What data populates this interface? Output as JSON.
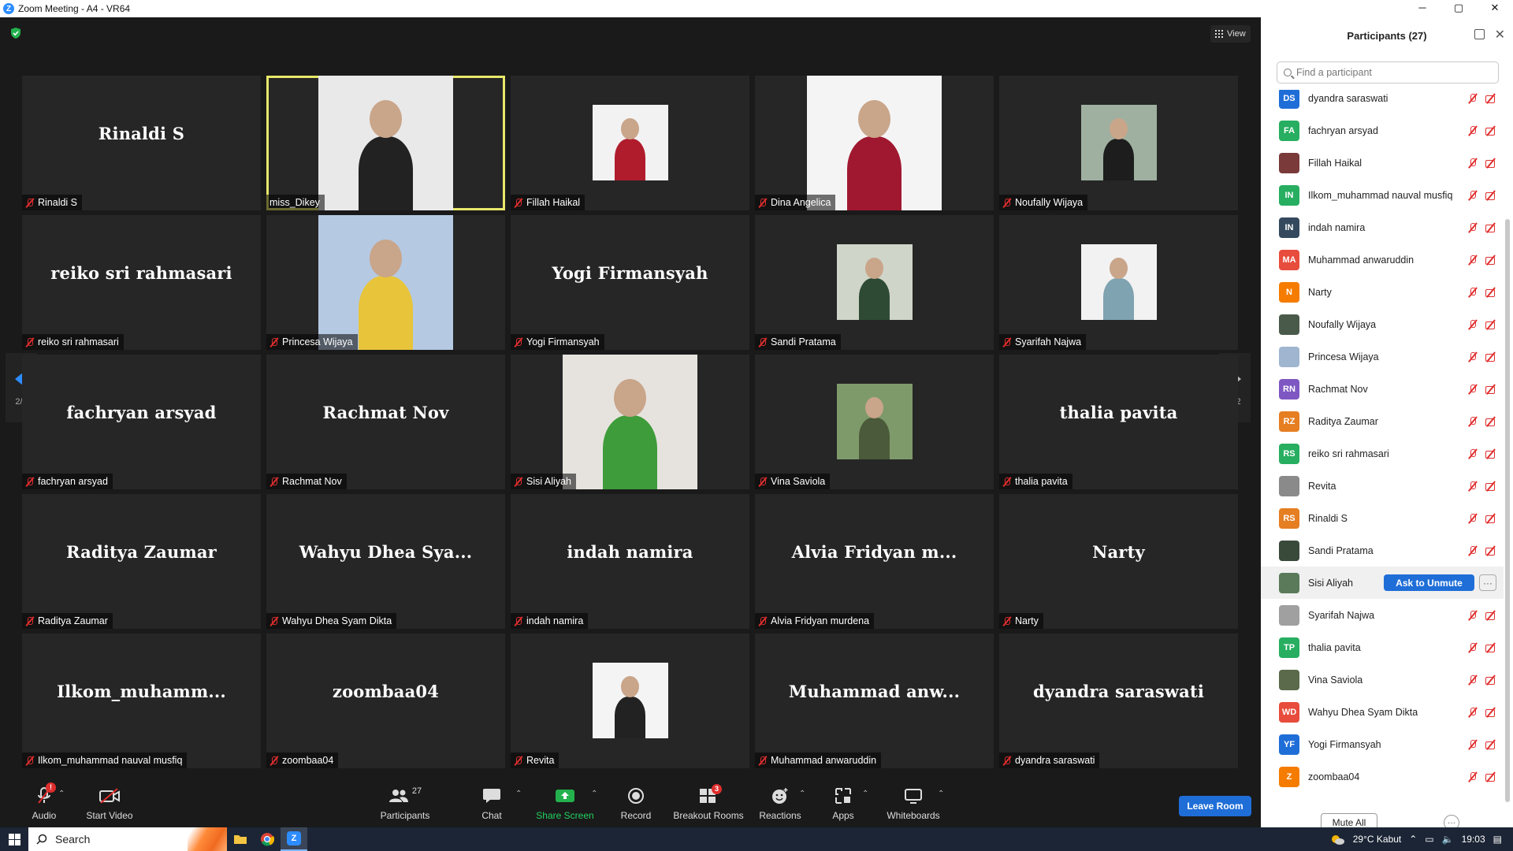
{
  "window": {
    "title": "Zoom Meeting - A4 - VR64",
    "minimize": "─",
    "maximize": "▢",
    "close": "✕"
  },
  "view_button": "View",
  "tiles": [
    {
      "id": "rinaldi",
      "big": "Rinaldi S",
      "name": "Rinaldi S",
      "photo": false
    },
    {
      "id": "dikey",
      "big": "",
      "name": "miss_Dikey",
      "photo": true,
      "active": true,
      "photo_color": "#e9e9e9",
      "accent": "#222"
    },
    {
      "id": "fillah",
      "big": "",
      "name": "Fillah Haikal",
      "photo": true,
      "small": true,
      "photo_color": "#f2f2f2",
      "accent": "#b01c2c"
    },
    {
      "id": "dina",
      "big": "",
      "name": "Dina Angelica",
      "photo": true,
      "photo_color": "#f4f4f4",
      "accent": "#a01830"
    },
    {
      "id": "noufally",
      "big": "",
      "name": "Noufally Wijaya",
      "photo": true,
      "small": true,
      "photo_color": "#9fb0a0",
      "accent": "#1d1d1d"
    },
    {
      "id": "reiko",
      "big": "reiko sri rahmasari",
      "name": "reiko sri rahmasari",
      "photo": false
    },
    {
      "id": "princesa",
      "big": "",
      "name": "Princesa Wijaya",
      "photo": true,
      "photo_color": "#b5c9e2",
      "accent": "#e8c43a"
    },
    {
      "id": "yogi",
      "big": "Yogi Firmansyah",
      "name": "Yogi Firmansyah",
      "photo": false
    },
    {
      "id": "sandi",
      "big": "",
      "name": "Sandi Pratama",
      "photo": true,
      "small": true,
      "photo_color": "#cfd5c8",
      "accent": "#2e4a34"
    },
    {
      "id": "syarifah",
      "big": "",
      "name": "Syarifah Najwa",
      "photo": true,
      "small": true,
      "photo_color": "#f2f2f2",
      "accent": "#7fa3b0"
    },
    {
      "id": "fachryan",
      "big": "fachryan arsyad",
      "name": "fachryan arsyad",
      "photo": false
    },
    {
      "id": "rachmat",
      "big": "Rachmat Nov",
      "name": "Rachmat Nov",
      "photo": false
    },
    {
      "id": "sisi",
      "big": "",
      "name": "Sisi Aliyah",
      "photo": true,
      "photo_color": "#e6e3df",
      "accent": "#3f9c3a"
    },
    {
      "id": "vina",
      "big": "",
      "name": "Vina Saviola",
      "photo": true,
      "small": true,
      "photo_color": "#7e9a6a",
      "accent": "#4a5a3a"
    },
    {
      "id": "thalia",
      "big": "thalia pavita",
      "name": "thalia pavita",
      "photo": false
    },
    {
      "id": "raditya",
      "big": "Raditya Zaumar",
      "name": "Raditya Zaumar",
      "photo": false
    },
    {
      "id": "wahyu",
      "big": "Wahyu Dhea Sya...",
      "name": "Wahyu Dhea Syam Dikta",
      "photo": false
    },
    {
      "id": "indah",
      "big": "indah namira",
      "name": "indah namira",
      "photo": false
    },
    {
      "id": "alvia",
      "big": "Alvia Fridyan m...",
      "name": "Alvia Fridyan murdena",
      "photo": false
    },
    {
      "id": "narty",
      "big": "Narty",
      "name": "Narty",
      "photo": false
    },
    {
      "id": "ilkom",
      "big": "Ilkom_muhamm...",
      "name": "Ilkom_muhammad nauval musfiq",
      "photo": false
    },
    {
      "id": "zoombaa",
      "big": "zoombaa04",
      "name": "zoombaa04",
      "photo": false
    },
    {
      "id": "revita",
      "big": "",
      "name": "Revita",
      "photo": true,
      "small": true,
      "photo_color": "#f4f4f4",
      "accent": "#222"
    },
    {
      "id": "muhammad",
      "big": "Muhammad anw...",
      "name": "Muhammad anwaruddin",
      "photo": false
    },
    {
      "id": "dyandra",
      "big": "dyandra saraswati",
      "name": "dyandra saraswati",
      "photo": false
    }
  ],
  "pagination": {
    "left": "2/2",
    "right": "2/2"
  },
  "toolbar": {
    "audio": "Audio",
    "audio_badge": "!",
    "start_video": "Start Video",
    "participants": "Participants",
    "participants_count": "27",
    "chat": "Chat",
    "share_screen": "Share Screen",
    "record": "Record",
    "breakout_rooms": "Breakout Rooms",
    "breakout_badge": "3",
    "reactions": "Reactions",
    "apps": "Apps",
    "whiteboards": "Whiteboards",
    "leave": "Leave Room"
  },
  "panel": {
    "title": "Participants (27)",
    "search_placeholder": "Find a participant",
    "mute_all": "Mute All",
    "more": "···",
    "ask_to_unmute": "Ask to Unmute",
    "row_more": "···",
    "participants": [
      {
        "initials": "DS",
        "name": "dyandra saraswati",
        "color": "#1f6ed8"
      },
      {
        "initials": "FA",
        "name": "fachryan arsyad",
        "color": "#27ae60"
      },
      {
        "initials": "",
        "name": "Fillah Haikal",
        "color": "#7a3a3a",
        "photo": true
      },
      {
        "initials": "IN",
        "name": "Ilkom_muhammad nauval musfiq",
        "color": "#27ae60"
      },
      {
        "initials": "IN",
        "name": "indah namira",
        "color": "#34495e"
      },
      {
        "initials": "MA",
        "name": "Muhammad anwaruddin",
        "color": "#e74c3c"
      },
      {
        "initials": "N",
        "name": "Narty",
        "color": "#f57c00"
      },
      {
        "initials": "",
        "name": "Noufally Wijaya",
        "color": "#4a5a4a",
        "photo": true
      },
      {
        "initials": "",
        "name": "Princesa Wijaya",
        "color": "#9fb5d0",
        "photo": true
      },
      {
        "initials": "RN",
        "name": "Rachmat Nov",
        "color": "#7e57c2"
      },
      {
        "initials": "RZ",
        "name": "Raditya Zaumar",
        "color": "#e67e22"
      },
      {
        "initials": "RS",
        "name": "reiko sri rahmasari",
        "color": "#27ae60"
      },
      {
        "initials": "",
        "name": "Revita",
        "color": "#8a8a8a",
        "photo": true
      },
      {
        "initials": "RS",
        "name": "Rinaldi S",
        "color": "#e67e22"
      },
      {
        "initials": "",
        "name": "Sandi Pratama",
        "color": "#3a4a3a",
        "photo": true
      },
      {
        "initials": "",
        "name": "Sisi Aliyah",
        "color": "#5a7a5a",
        "photo": true,
        "hover": true
      },
      {
        "initials": "",
        "name": "Syarifah Najwa",
        "color": "#a0a0a0",
        "photo": true
      },
      {
        "initials": "TP",
        "name": "thalia pavita",
        "color": "#27ae60"
      },
      {
        "initials": "",
        "name": "Vina Saviola",
        "color": "#5a6a4a",
        "photo": true
      },
      {
        "initials": "WD",
        "name": "Wahyu Dhea Syam Dikta",
        "color": "#e74c3c"
      },
      {
        "initials": "YF",
        "name": "Yogi Firmansyah",
        "color": "#1f6ed8"
      },
      {
        "initials": "Z",
        "name": "zoombaa04",
        "color": "#f57c00"
      }
    ]
  },
  "taskbar": {
    "search": "Search",
    "weather": "29°C  Kabut",
    "time": "19:03"
  },
  "colors": {
    "accent": "#2d8cff",
    "active_speaker": "#e8e86a",
    "muted": "#e02d2d",
    "leave": "#1f6ed8"
  }
}
